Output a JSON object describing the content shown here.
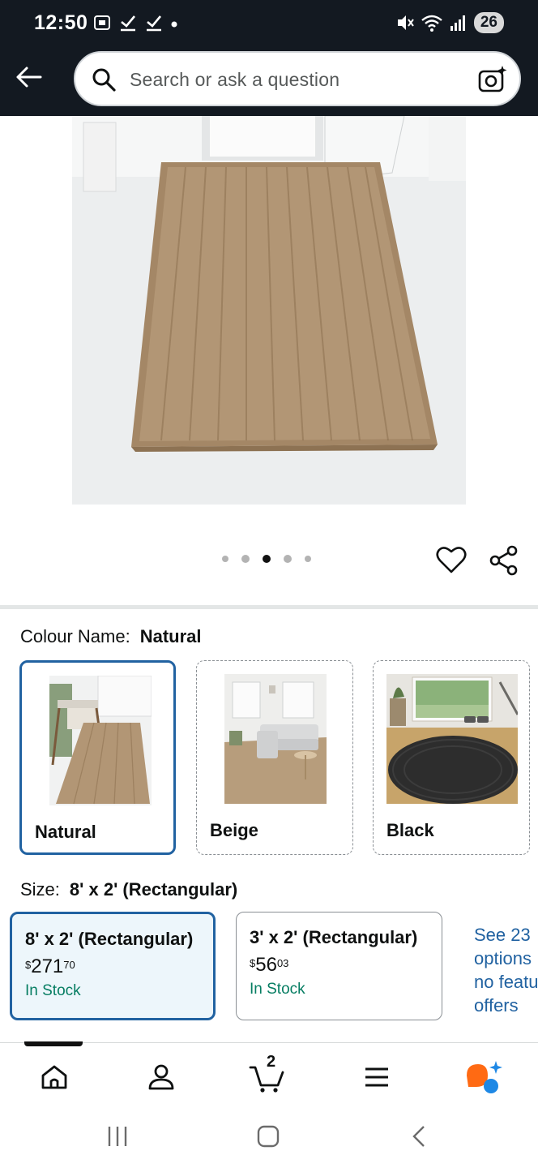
{
  "status_bar": {
    "time": "12:50",
    "battery": "26"
  },
  "header": {
    "search_placeholder": "Search or ask a question"
  },
  "carousel": {
    "dots": 5,
    "active_index": 2
  },
  "colour": {
    "label": "Colour Name:",
    "selected": "Natural",
    "options": [
      {
        "name": "Natural",
        "selected": true
      },
      {
        "name": "Beige",
        "selected": false
      },
      {
        "name": "Black",
        "selected": false
      }
    ]
  },
  "size": {
    "label": "Size:",
    "selected": "8' x 2' (Rectangular)",
    "options": [
      {
        "title": "8' x 2' (Rectangular)",
        "currency": "$",
        "whole": "271",
        "fraction": "70",
        "stock": "In Stock",
        "selected": true
      },
      {
        "title": "3' x 2' (Rectangular)",
        "currency": "$",
        "whole": "56",
        "fraction": "03",
        "stock": "In Stock",
        "selected": false
      }
    ],
    "see_more_lines": [
      "See 23",
      "options",
      "no featu",
      "offers"
    ]
  },
  "bottom_nav": {
    "cart_count": "2"
  },
  "colors": {
    "header_bg": "#131921",
    "accent_blue": "#2162a1",
    "stock_green": "#067d62",
    "rufus_orange": "#ff6a13"
  }
}
